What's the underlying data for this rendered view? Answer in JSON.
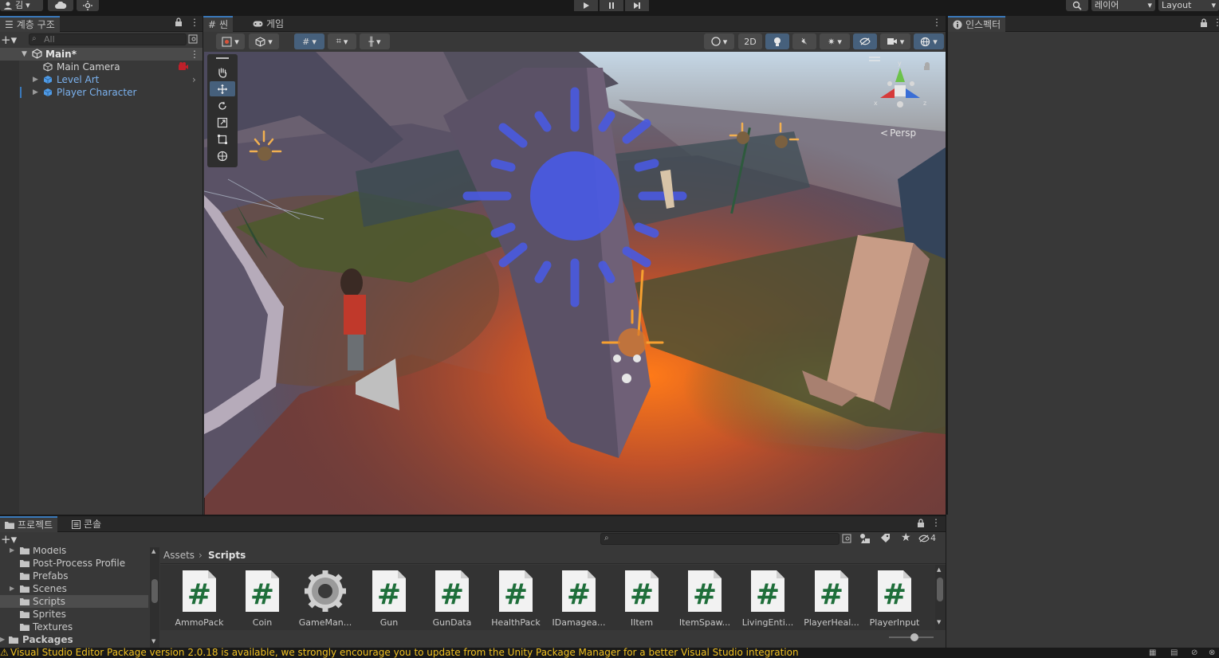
{
  "toolbar": {
    "account_label": "김",
    "layers_label": "레이어",
    "layout_label": "Layout"
  },
  "hierarchy": {
    "tab_label": "계층 구조",
    "search_placeholder": "All",
    "scene_name": "Main*",
    "items": [
      {
        "label": "Main Camera"
      },
      {
        "label": "Level Art"
      },
      {
        "label": "Player Character"
      }
    ]
  },
  "scene_view": {
    "tabs": [
      {
        "label": "씬"
      },
      {
        "label": "게임"
      }
    ],
    "btn_2d": "2D",
    "persp_label": "Persp",
    "gizmo_axes": {
      "x": "x",
      "y": "y",
      "z": "z"
    }
  },
  "inspector": {
    "tab_label": "인스펙터"
  },
  "project": {
    "tabs": [
      {
        "label": "프로젝트"
      },
      {
        "label": "콘솔"
      }
    ],
    "folders": [
      {
        "label": "Models"
      },
      {
        "label": "Post-Process Profile"
      },
      {
        "label": "Prefabs"
      },
      {
        "label": "Scenes"
      },
      {
        "label": "Scripts"
      },
      {
        "label": "Sprites"
      },
      {
        "label": "Textures"
      },
      {
        "label": "Packages"
      }
    ],
    "breadcrumb": {
      "root": "Assets",
      "current": "Scripts"
    },
    "hidden_count": "4",
    "assets": [
      {
        "label": "AmmoPack",
        "icon": "csharp-script-icon"
      },
      {
        "label": "Coin",
        "icon": "csharp-script-icon"
      },
      {
        "label": "GameMan...",
        "icon": "gear-icon"
      },
      {
        "label": "Gun",
        "icon": "csharp-script-icon"
      },
      {
        "label": "GunData",
        "icon": "csharp-script-icon"
      },
      {
        "label": "HealthPack",
        "icon": "csharp-script-icon"
      },
      {
        "label": "IDamagea...",
        "icon": "csharp-script-icon"
      },
      {
        "label": "IItem",
        "icon": "csharp-script-icon"
      },
      {
        "label": "ItemSpaw...",
        "icon": "csharp-script-icon"
      },
      {
        "label": "LivingEnti...",
        "icon": "csharp-script-icon"
      },
      {
        "label": "PlayerHeal...",
        "icon": "csharp-script-icon"
      },
      {
        "label": "PlayerInput",
        "icon": "csharp-script-icon"
      }
    ],
    "script_glyph": "#"
  },
  "status": {
    "message": "Visual Studio Editor Package version 2.0.18 is available, we strongly encourage you to update from the Unity Package Manager for a better Visual Studio integration"
  },
  "colors": {
    "accent": "#3a79bb",
    "selection": "#46607c",
    "warning": "#f0c020",
    "prefab_blue": "#7bb2ef",
    "script_green": "#1e6e3a",
    "light_gizmo": "#4a5ae0"
  }
}
